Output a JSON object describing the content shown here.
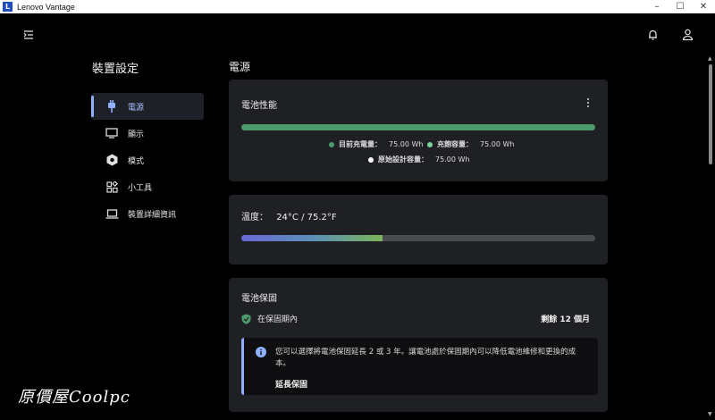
{
  "window": {
    "title": "Lenovo Vantage",
    "logo_letter": "L",
    "min": "–",
    "max": "☐",
    "close": "✕"
  },
  "page": {
    "title": "裝置設定"
  },
  "sidebar": {
    "items": [
      {
        "label": "電源",
        "icon": "plug-icon",
        "active": true
      },
      {
        "label": "顯示",
        "icon": "monitor-icon"
      },
      {
        "label": "模式",
        "icon": "hexagon-mode-icon"
      },
      {
        "label": "小工具",
        "icon": "widgets-icon"
      },
      {
        "label": "裝置詳細資訊",
        "icon": "laptop-icon"
      }
    ]
  },
  "main": {
    "section_title": "電源",
    "battery_performance": {
      "title": "電池性能",
      "charge_fraction": 1.0,
      "legend": [
        {
          "label": "目前充電量：",
          "value": "75.00 Wh",
          "color": "#4f9a6c"
        },
        {
          "label": "充飽容量：",
          "value": "75.00 Wh",
          "color": "#7ed49a"
        },
        {
          "label": "原始設計容量：",
          "value": "75.00 Wh",
          "color": "#ffffff"
        }
      ]
    },
    "temperature": {
      "label": "溫度：",
      "value": "24°C / 75.2°F",
      "level_fraction": 0.4
    },
    "warranty": {
      "title": "電池保固",
      "status": "在保固期內",
      "remaining": "剩餘 12 個月",
      "info_text": "您可以選擇將電池保固延長 2 或 3 年。讓電池處於保固期內可以降低電池維修和更換的成本。",
      "extend_link": "延長保固"
    }
  },
  "watermark": "原價屋Coolpc",
  "colors": {
    "accent": "#8fb0ff",
    "battery_bar": "#4f9a6c",
    "card_bg": "#1f2024"
  }
}
